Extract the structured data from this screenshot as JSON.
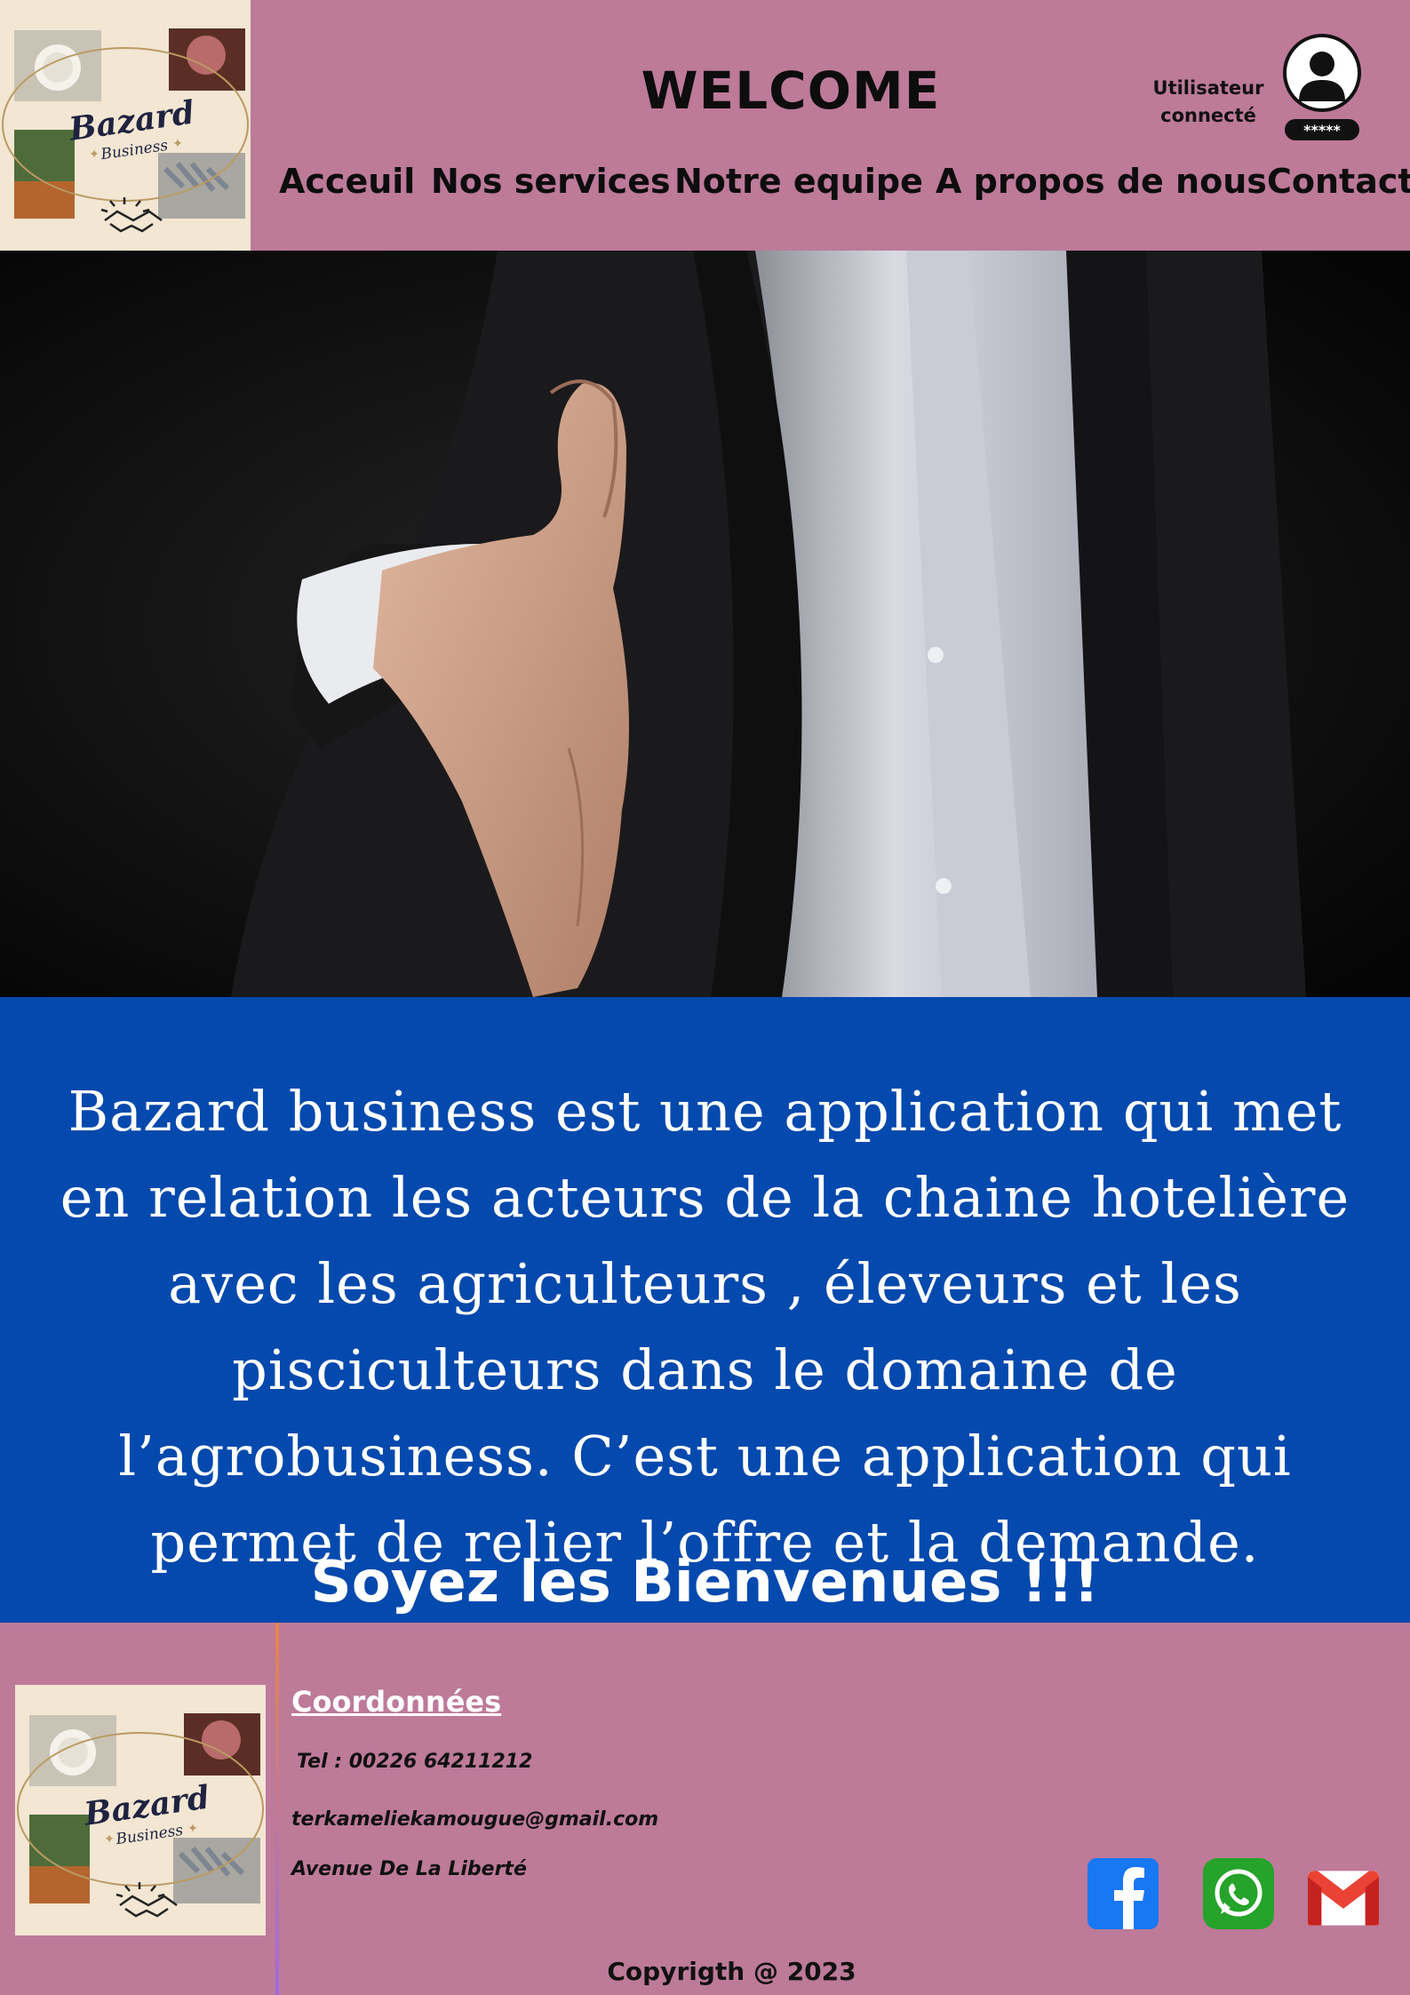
{
  "header": {
    "logo": {
      "brand_line1": "Bazard",
      "brand_line2": "Business"
    },
    "title": "WELCOME",
    "user": {
      "status_line1": "Utilisateur",
      "status_line2": "connecté",
      "password_mask": "*****",
      "icon": "user-lock-icon"
    }
  },
  "nav": {
    "items": [
      {
        "label": "Acceuil"
      },
      {
        "label": "Nos services"
      },
      {
        "label": "Notre equipe"
      },
      {
        "label": "A propos de nous"
      },
      {
        "label": "Contact"
      }
    ]
  },
  "hero": {
    "image": "handshake-offer-photo"
  },
  "intro": {
    "text": "Bazard business  est une application qui met en relation les acteurs de la chaine hotelière avec les agriculteurs , éleveurs et les pisciculteurs dans le domaine de l’agrobusiness. C’est une application qui permet de relier l’offre et la demande.",
    "welcome": "Soyez les Bienvenues !!!"
  },
  "footer": {
    "logo": {
      "brand_line1": "Bazard",
      "brand_line2": "Business"
    },
    "contact_title": "Coordonnées",
    "phone": "Tel : 00226 64211212",
    "email": "terkameliekamougue@gmail.com",
    "address": "Avenue De La Liberté",
    "social": [
      {
        "icon": "facebook-icon",
        "color": "#1877f2"
      },
      {
        "icon": "whatsapp-icon",
        "color": "#25a32a"
      },
      {
        "icon": "gmail-icon",
        "color": "#ea4335"
      }
    ],
    "copyright": "Copyrigth @ 2023"
  },
  "colors": {
    "header_bg": "#bd7a99",
    "band_bg": "#0449ad",
    "footer_bg": "#bd7a99"
  }
}
